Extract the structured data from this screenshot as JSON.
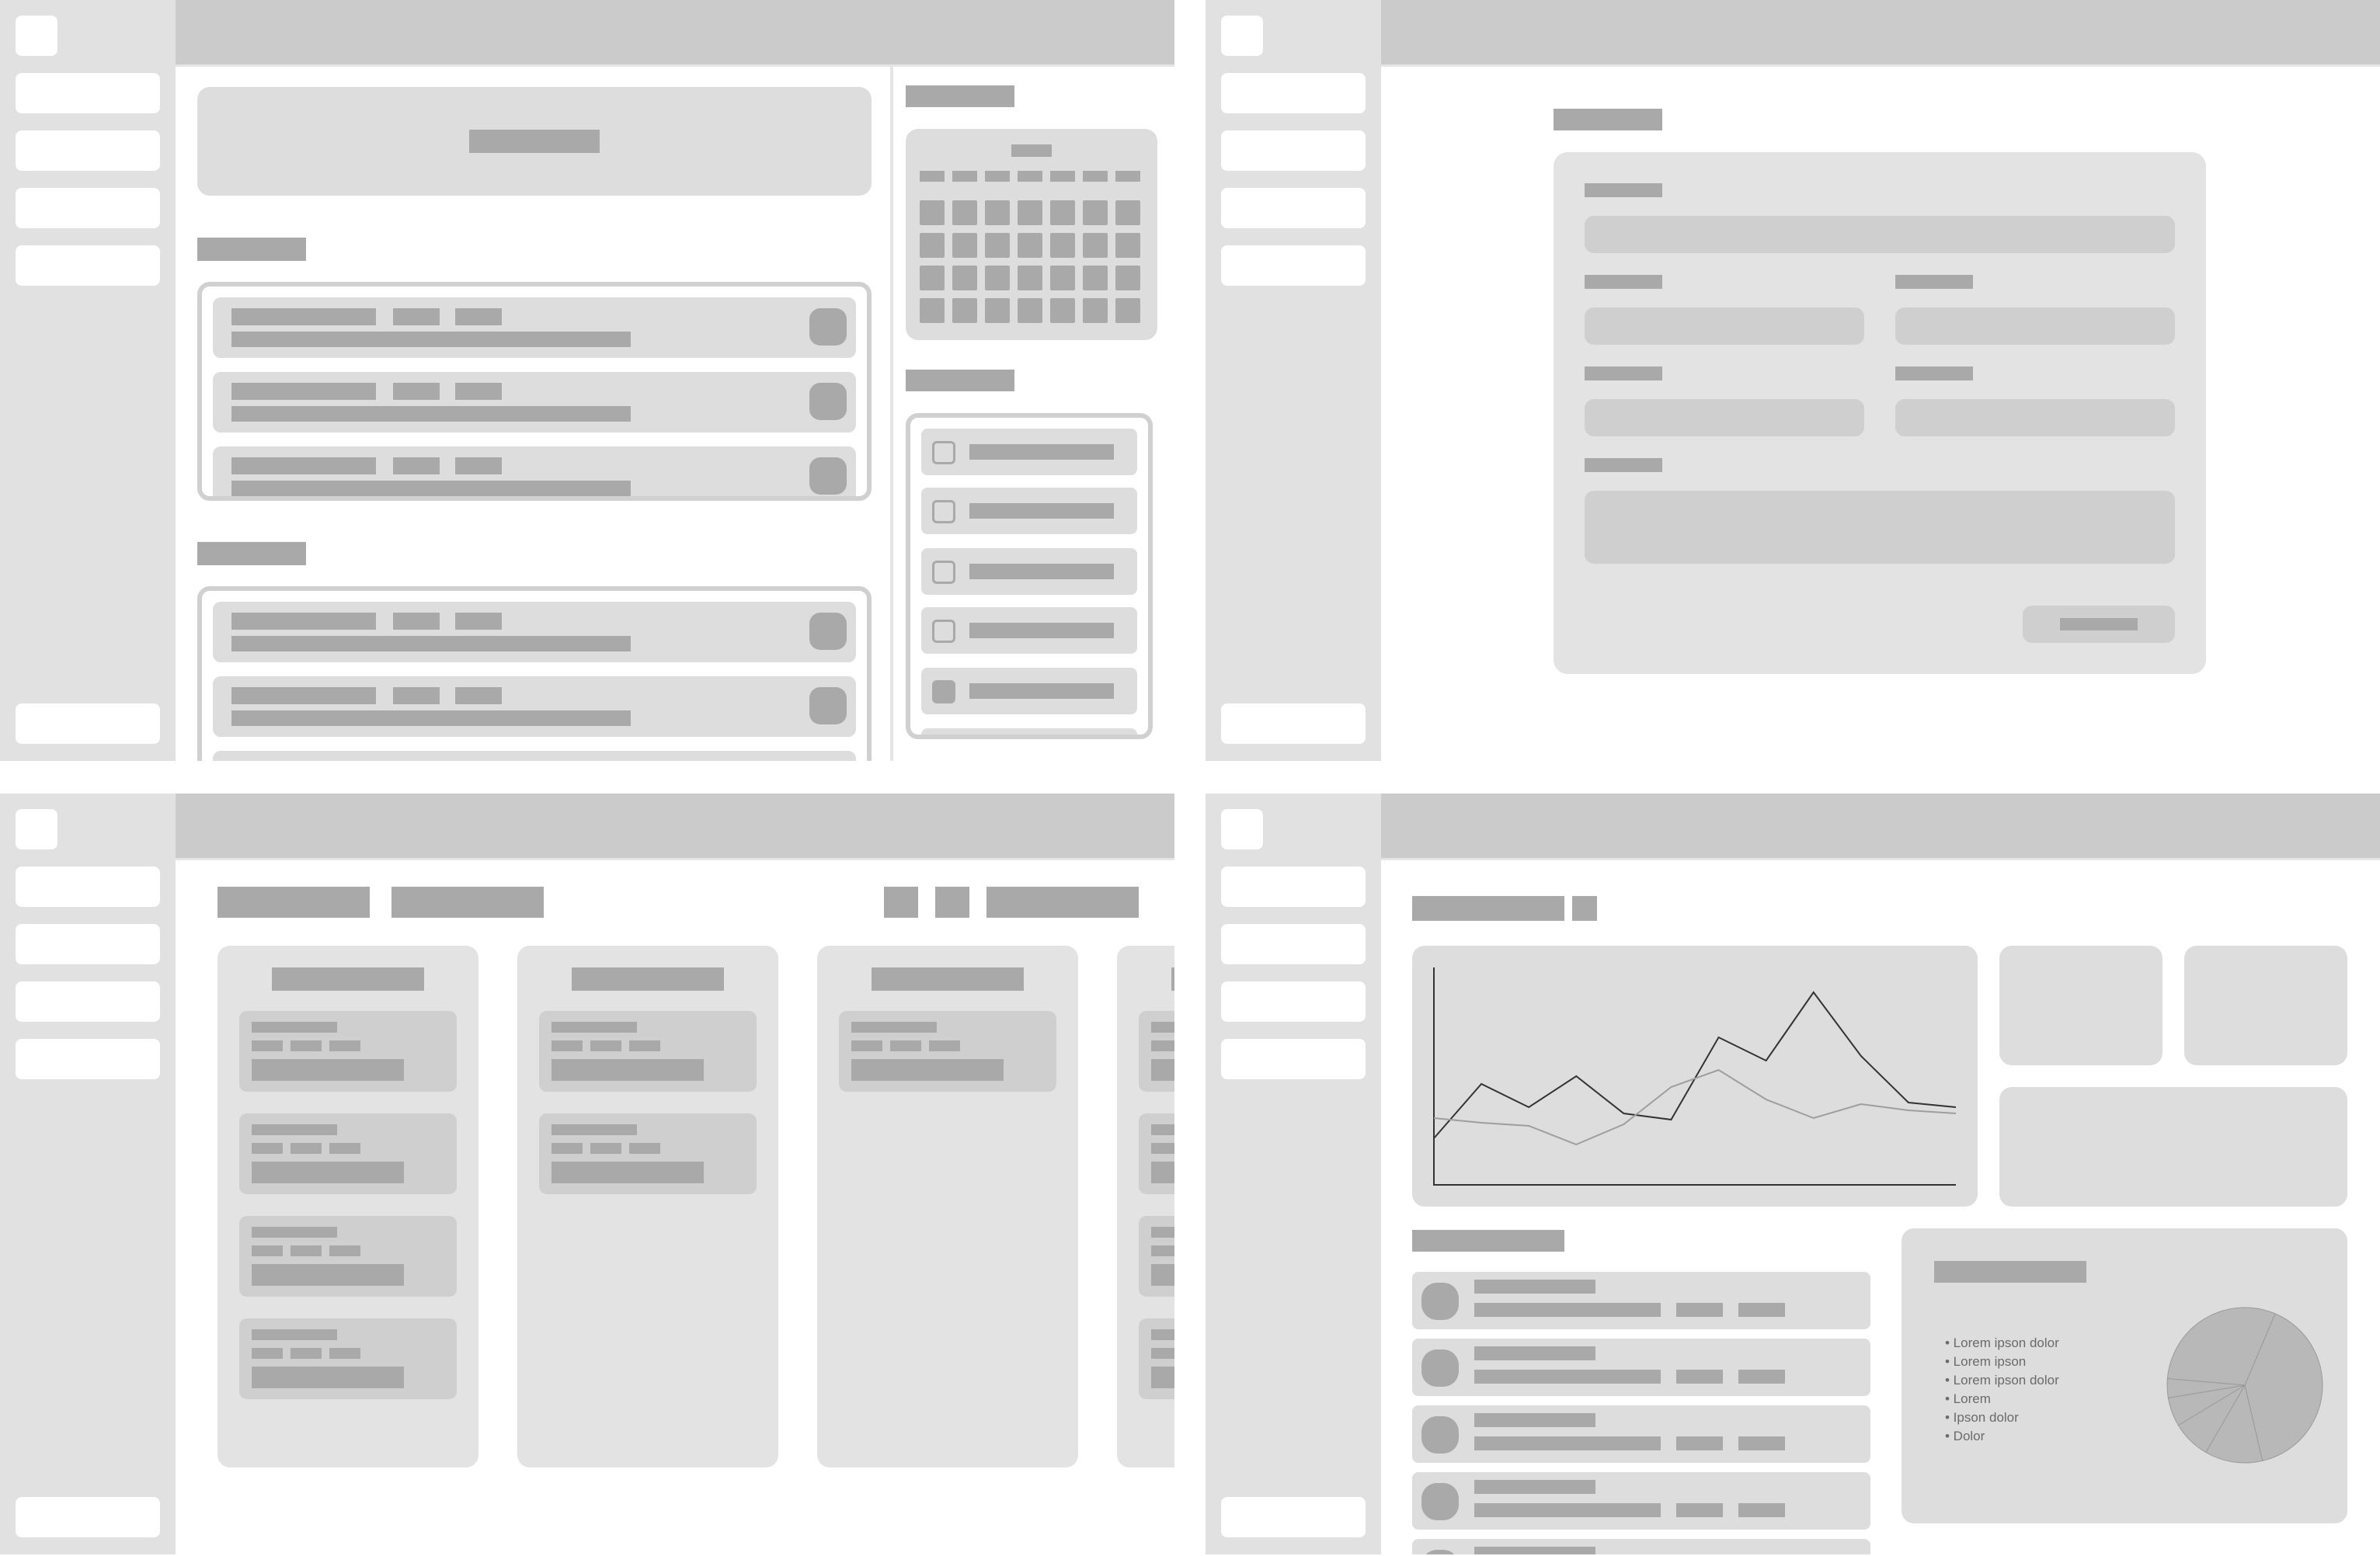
{
  "dashboard": {
    "legend": [
      "Lorem ipson dolor",
      "Lorem ipson",
      "Lorem ipson dolor",
      "Lorem",
      "Ipson dolor",
      "Dolor"
    ]
  },
  "colors": {
    "sidebar": "#e1e1e1",
    "topbar": "#cbcbcb",
    "card": "#dddddd",
    "placeholder_bar": "#a9a9a9",
    "card_alt": "#e3e3e3",
    "line_series_1": "#333333",
    "line_series_2": "#9e9e9e",
    "pie": "#b8b8b8"
  },
  "chart_data": {
    "type": "line",
    "x": [
      0,
      1,
      2,
      3,
      4,
      5,
      6,
      7,
      8,
      9,
      10,
      11
    ],
    "series": [
      {
        "values": [
          3,
          6.5,
          5,
          7,
          4.6,
          4.2,
          9.5,
          8,
          12.4,
          8.3,
          5.3,
          5
        ]
      },
      {
        "values": [
          4.3,
          4.0,
          3.8,
          2.6,
          3.9,
          6.3,
          7.4,
          5.5,
          4.3,
          5.2,
          4.8,
          4.6
        ]
      }
    ],
    "ylim": [
      0,
      14
    ],
    "grid": false
  },
  "pie_data": {
    "type": "pie",
    "values": [
      40,
      12,
      8,
      6,
      4,
      30
    ]
  }
}
